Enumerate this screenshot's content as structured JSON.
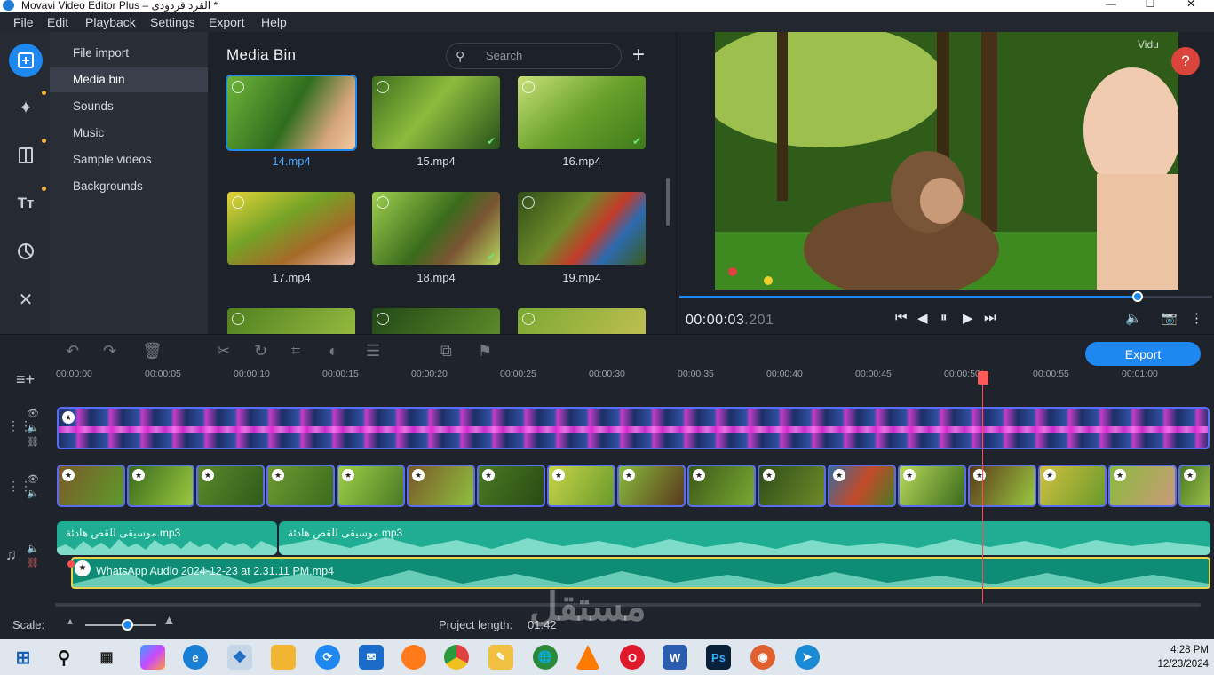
{
  "window": {
    "title": "Movavi Video Editor Plus – القرد قردودى *",
    "min": "—",
    "max": "☐",
    "close": "✕"
  },
  "menu": [
    "File",
    "Edit",
    "Playback",
    "Settings",
    "Export",
    "Help"
  ],
  "sidebar_tools": [
    "import-icon",
    "effects-icon",
    "transitions-icon",
    "titles-icon",
    "stickers-icon",
    "tools-icon"
  ],
  "categories": [
    "File import",
    "Media bin",
    "Sounds",
    "Music",
    "Sample videos",
    "Backgrounds"
  ],
  "active_category": "Media bin",
  "media_bin": {
    "title": "Media Bin",
    "search_placeholder": "Search",
    "add": "+",
    "files": [
      "14.mp4",
      "15.mp4",
      "16.mp4",
      "17.mp4",
      "18.mp4",
      "19.mp4"
    ],
    "selected": "14.mp4"
  },
  "preview": {
    "watermark": "Vidu",
    "help": "?",
    "timecode_main": "00:00:03",
    "timecode_ms": ".201",
    "progress": 0.86
  },
  "editor": {
    "export_label": "Export",
    "ruler": [
      "00:00:00",
      "00:00:05",
      "00:00:10",
      "00:00:15",
      "00:00:20",
      "00:00:25",
      "00:00:30",
      "00:00:35",
      "00:00:40",
      "00:00:45",
      "00:00:50",
      "00:00:55",
      "00:01:00"
    ],
    "audio_track1": [
      "موسيقى للقص هادئة.mp3",
      "موسيقى للقص هادئة.mp3"
    ],
    "audio_track2": "WhatsApp Audio 2024-12-23 at 2.31.11 PM.mp4",
    "scale_label": "Scale:",
    "project_length_label": "Project length:",
    "project_length": "01:42"
  },
  "watermark_text": "مستقل",
  "taskbar": {
    "time": "4:28 PM",
    "date": "12/23/2024"
  },
  "colors": {
    "accent": "#1e88f0",
    "audio": "#1fae93",
    "playhead": "#ff4c4c"
  }
}
